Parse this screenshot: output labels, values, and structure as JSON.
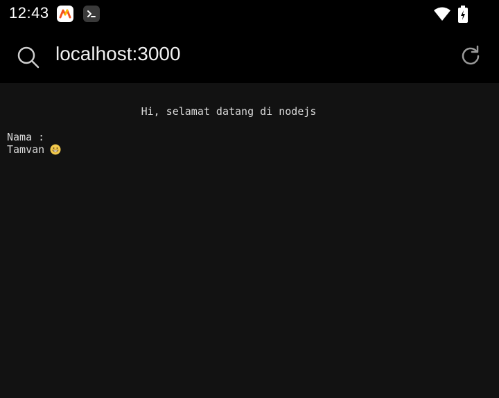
{
  "status_bar": {
    "time": "12:43",
    "icons": [
      "app-logo-icon",
      "terminal-icon",
      "wifi-icon",
      "battery-icon"
    ]
  },
  "address_bar": {
    "url": "localhost:3000",
    "icons": [
      "search-icon",
      "reload-icon"
    ]
  },
  "page": {
    "greeting": "Hi, selamat datang di nodejs",
    "name_label": "Nama :",
    "name_value": "Tamvan",
    "emoji_icon": "grinning-face-icon"
  },
  "colors": {
    "background": "#121212",
    "bars": "#000000",
    "text": "#d9d9d9"
  }
}
